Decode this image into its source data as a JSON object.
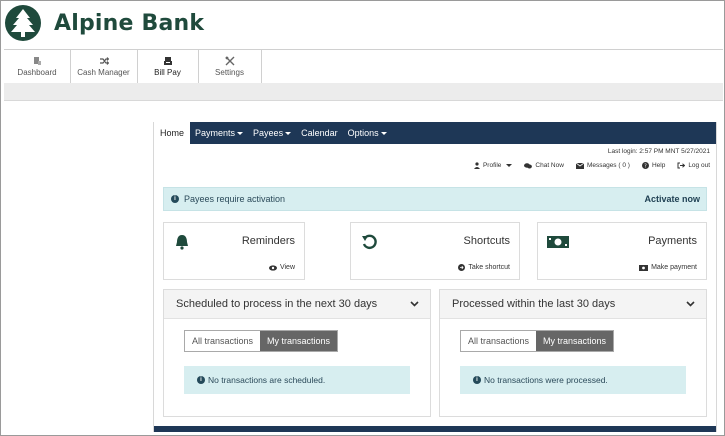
{
  "brand": {
    "name": "Alpine Bank",
    "color": "#1f4a3c"
  },
  "nav": {
    "tabs": [
      {
        "label": "Dashboard",
        "icon": "dashboard-icon"
      },
      {
        "label": "Cash Manager",
        "icon": "shuffle-icon"
      },
      {
        "label": "Bill Pay",
        "icon": "bill-pay-icon"
      },
      {
        "label": "Settings",
        "icon": "tools-icon"
      }
    ]
  },
  "subnav": {
    "items": [
      "Home",
      "Payments",
      "Payees",
      "Calendar",
      "Options"
    ],
    "color": "#1e3756"
  },
  "session": {
    "last_login": "Last login: 2:57 PM MNT 5/27/2021",
    "links": [
      "Profile",
      "Chat Now",
      "Messages ( 0 )",
      "Help",
      "Log out"
    ]
  },
  "alert": {
    "text": "Payees require activation",
    "action": "Activate now"
  },
  "cards": [
    {
      "title": "Reminders",
      "link": "View",
      "icon": "bell-icon"
    },
    {
      "title": "Shortcuts",
      "link": "Take shortcut",
      "icon": "undo-icon"
    },
    {
      "title": "Payments",
      "link": "Make payment",
      "icon": "money-icon"
    }
  ],
  "scheduled": {
    "title": "Scheduled to process in the next 30 days",
    "toggle": [
      "All transactions",
      "My transactions"
    ],
    "empty": "No transactions are scheduled."
  },
  "processed": {
    "title": "Processed within the last 30 days",
    "toggle": [
      "All transactions",
      "My transactions"
    ],
    "empty": "No transactions were processed."
  },
  "colors": {
    "accent": "#1e3756",
    "info_bg": "#d7eef0",
    "icon_green": "#1f4a3c"
  }
}
